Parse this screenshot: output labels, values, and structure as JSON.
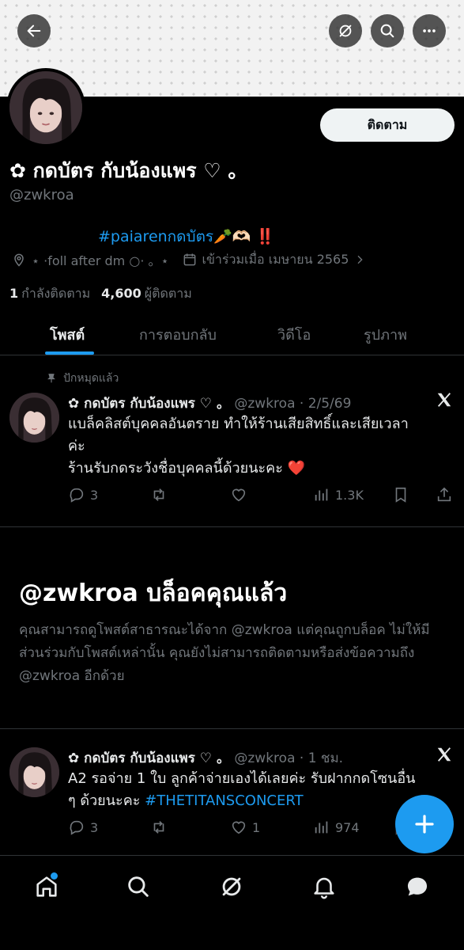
{
  "profile": {
    "name": "✿ กดบัตร กับน้องแพร ♡ 。",
    "handle": "@zwkroa",
    "follow_label": "ติดตาม",
    "bio_hashtag": "#paiarenกดบัตร",
    "bio_suffix": "🥕🫶🏻 ‼️",
    "location": "⋆ ·foll after dm ○· 。⋆",
    "joined": "เข้าร่วมเมื่อ เมษายน 2565",
    "following_count": "1",
    "following_label": "กำลังติดตาม",
    "followers_count": "4,600",
    "followers_label": "ผู้ติดตาม"
  },
  "tabs": [
    {
      "label": "โพสต์",
      "active": true
    },
    {
      "label": "การตอบกลับ",
      "active": false
    },
    {
      "label": "วิดีโอ",
      "active": false
    },
    {
      "label": "รูปภาพ",
      "active": false
    }
  ],
  "pinned_post": {
    "pinned_label": "ปักหมุดแล้ว",
    "author": "✿ กดบัตร กับน้องแพร ♡ 。",
    "meta": "@zwkroa · 2/5/69",
    "line1": "แบล็คลิสต์บุคคลอันตราย ทำให้ร้านเสียสิทธิ์และเสียเวลา",
    "line2": "ค่ะ",
    "line3": "ร้านรับกดระวังชื่อบุคคลนี้ด้วยนะคะ ❤️",
    "replies": "3",
    "likes": "",
    "views": "1.3K"
  },
  "blocked": {
    "title": "@zwkroa บล็อคคุณแล้ว",
    "text": "คุณสามารถดูโพสต์สาธารณะได้จาก @zwkroa แต่คุณถูกบล็อค ไม่ให้มีส่วนร่วมกับโพสต์เหล่านั้น คุณยังไม่สามารถติดตามหรือส่งข้อความถึง @zwkroa อีกด้วย"
  },
  "post2": {
    "author": "✿ กดบัตร กับน้องแพร ♡ 。",
    "meta": "@zwkroa · 1 ชม.",
    "line1": "A2 รอจ่าย 1 ใบ ลูกค้าจ่ายเองได้เลยค่ะ รับฝากกดโซนอื่น",
    "line2": "ๆ ด้วยนะคะ ",
    "hashtag": "#THETITANSCONCERT",
    "replies": "3",
    "likes": "1",
    "views": "974"
  },
  "colors": {
    "accent": "#1d9bf0",
    "background": "#000000",
    "muted": "#71767b",
    "text": "#e7e9ea"
  }
}
